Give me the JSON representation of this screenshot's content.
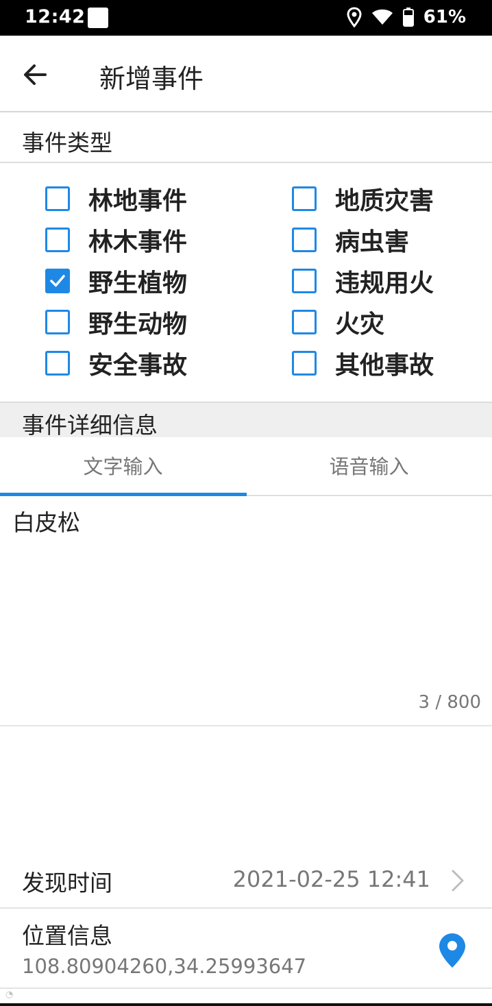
{
  "status_bar": {
    "time": "12:42",
    "battery_percent": "61%",
    "icons": [
      "notification-square-icon",
      "location-pin-icon",
      "wifi-icon",
      "battery-icon"
    ]
  },
  "app_bar": {
    "title": "新增事件",
    "back_icon": "arrow-left-icon"
  },
  "event_type": {
    "heading": "事件类型",
    "options": [
      {
        "label": "林地事件",
        "checked": false
      },
      {
        "label": "地质灾害",
        "checked": false
      },
      {
        "label": "林木事件",
        "checked": false
      },
      {
        "label": "病虫害",
        "checked": false
      },
      {
        "label": "野生植物",
        "checked": true
      },
      {
        "label": "违规用火",
        "checked": false
      },
      {
        "label": "野生动物",
        "checked": false
      },
      {
        "label": "火灾",
        "checked": false
      },
      {
        "label": "安全事故",
        "checked": false
      },
      {
        "label": "其他事故",
        "checked": false
      }
    ]
  },
  "details": {
    "heading": "事件详细信息",
    "tabs": [
      {
        "label": "文字输入",
        "active": true
      },
      {
        "label": "语音输入",
        "active": false
      }
    ],
    "text_value": "白皮松",
    "counter": "3 / 800"
  },
  "discovery_time": {
    "label": "发现时间",
    "value": "2021-02-25 12:41"
  },
  "location": {
    "label": "位置信息",
    "value": "108.80904260,34.25993647"
  },
  "colors": {
    "accent": "#1e88e5",
    "status_bar": "#000000"
  }
}
